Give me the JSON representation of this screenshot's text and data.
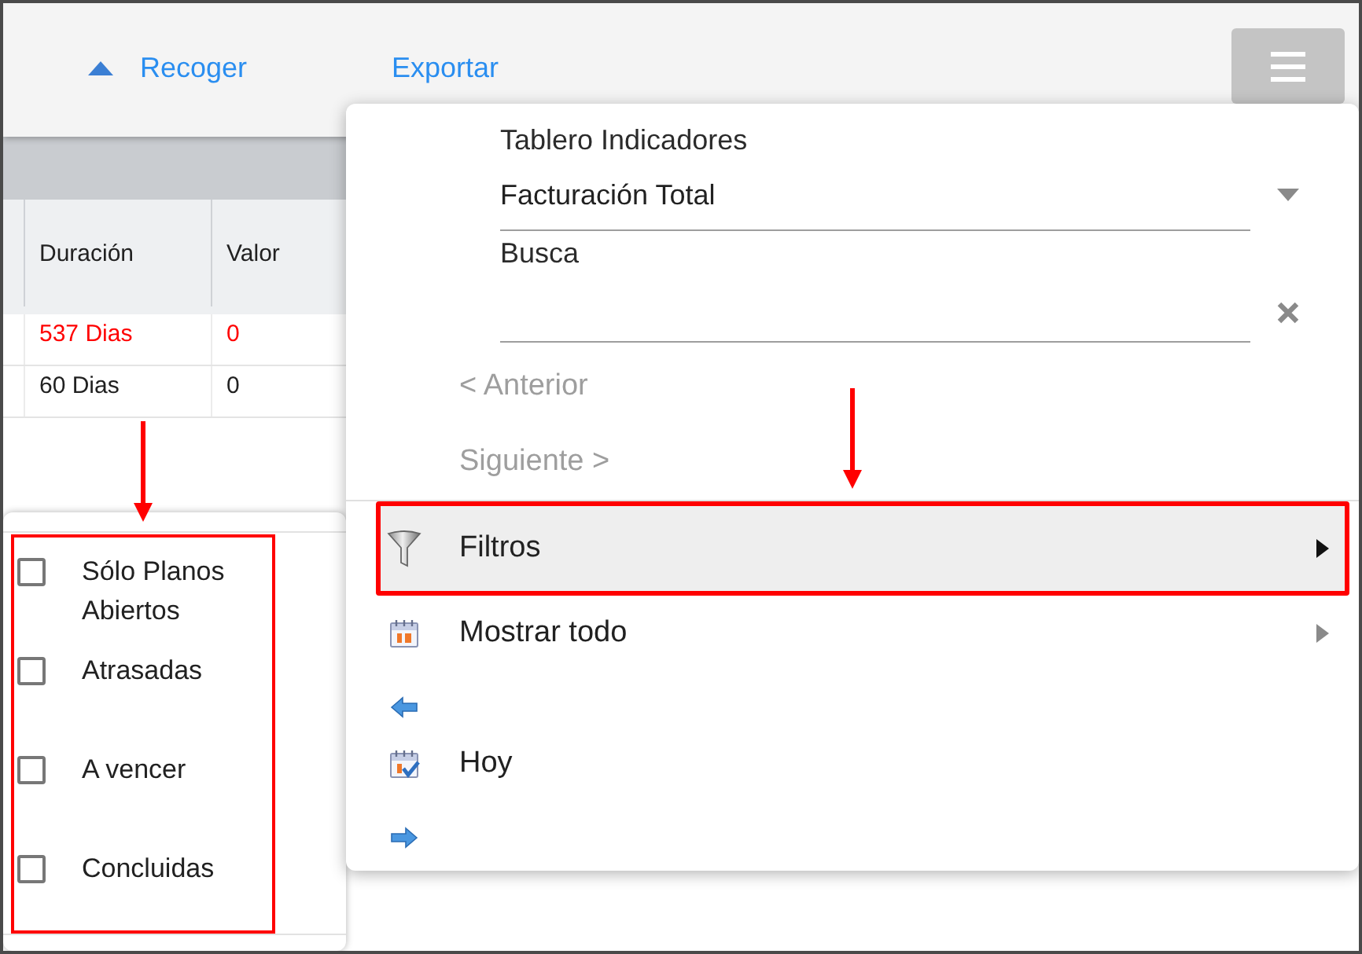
{
  "toolbar": {
    "collapse_link": {
      "label": "Recoger"
    },
    "export_link": {
      "label": "Exportar"
    }
  },
  "table": {
    "columns": [
      "Duración",
      "Valor"
    ],
    "rows": [
      {
        "cells": [
          "537 Dias",
          "0"
        ],
        "color": "#ff0000"
      },
      {
        "cells": [
          "60 Dias",
          "0"
        ],
        "color": "#212121"
      }
    ]
  },
  "menu": {
    "indicator": {
      "label": "Tablero Indicadores",
      "value": "Facturación Total"
    },
    "search": {
      "label": "Busca"
    },
    "nav": [
      {
        "label": "< Anterior",
        "disabled": true
      },
      {
        "label": "Siguiente >",
        "disabled": true
      }
    ],
    "items": [
      {
        "kind": "filter",
        "label": "Filtros",
        "submenu": true,
        "selected": true,
        "highlighted": true
      },
      {
        "kind": "show_all",
        "label": "Mostrar todo",
        "submenu": true,
        "selected": false,
        "highlighted": false
      },
      {
        "kind": "back",
        "submenu": false,
        "selected": false,
        "highlighted": false
      },
      {
        "kind": "today",
        "label": "Hoy",
        "submenu": false,
        "selected": false,
        "highlighted": false
      },
      {
        "kind": "forward",
        "submenu": false,
        "selected": false,
        "highlighted": false
      }
    ]
  },
  "filter_panel": {
    "highlighted": true,
    "options": [
      {
        "label": "Sólo Planos Abiertos",
        "checked": false
      },
      {
        "label": "Atrasadas",
        "checked": false
      },
      {
        "label": "A vencer",
        "checked": false
      },
      {
        "label": "Concluidas",
        "checked": false
      }
    ]
  }
}
